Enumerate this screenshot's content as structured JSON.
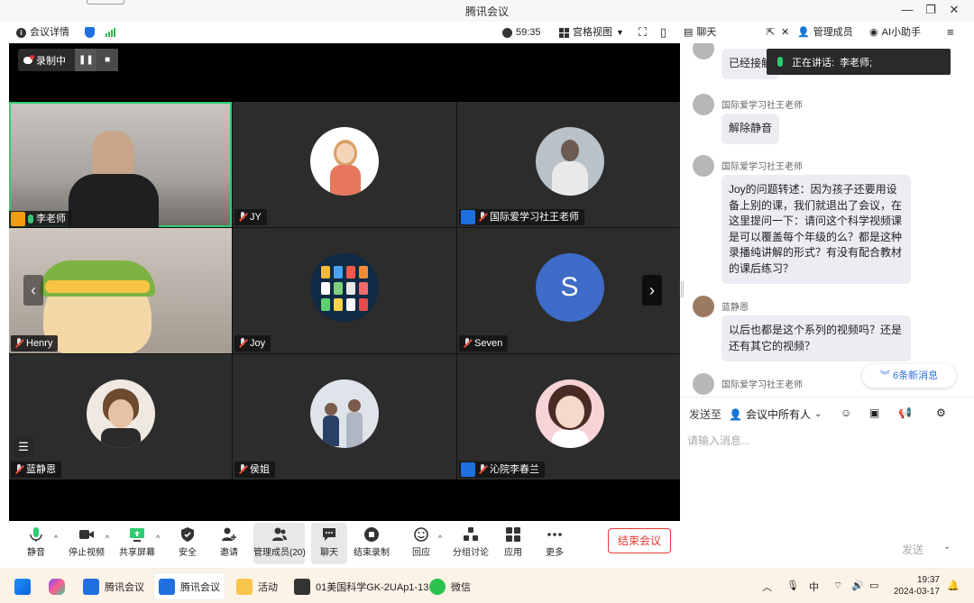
{
  "window": {
    "title": "腾讯会议"
  },
  "topbar": {
    "meeting_info": "会议详情",
    "timer": "59:35",
    "view_mode": "宫格视图"
  },
  "chat_header": {
    "chat": "聊天",
    "manage_members": "管理成员",
    "ai_assistant": "AI小助手"
  },
  "recording": {
    "label": "录制中"
  },
  "speaking": {
    "prefix": "正在讲话:",
    "name": "李老师;"
  },
  "tiles": [
    {
      "name": "李老师"
    },
    {
      "name": "JY"
    },
    {
      "name": "国际爱学习社王老师"
    },
    {
      "name": "Henry"
    },
    {
      "name": "Joy"
    },
    {
      "name": "Seven",
      "initial": "S"
    },
    {
      "name": "蓝静恩"
    },
    {
      "name": "侯姐"
    },
    {
      "name": "沁院李春兰"
    }
  ],
  "toolbar": {
    "mute": "静音",
    "stop_video": "停止视频",
    "share_screen": "共享屏幕",
    "security": "安全",
    "invite": "邀请",
    "members": "管理成员(20)",
    "chat": "聊天",
    "end_recording": "结束录制",
    "react": "回应",
    "breakout": "分组讨论",
    "apps": "应用",
    "more": "更多",
    "end_meeting": "结束会议"
  },
  "chat": {
    "messages": [
      {
        "sender": "",
        "text": "已经接触"
      },
      {
        "sender": "国际爱学习社王老师",
        "text": "解除静音"
      },
      {
        "sender": "国际爱学习社王老师",
        "text": "Joy的问题转述：因为孩子还要用设备上别的课，我们就退出了会议，在这里提问一下：请问这个科学视频课是可以覆盖每个年级的么？都是这种录播纯讲解的形式？有没有配合教材的课后练习？"
      },
      {
        "sender": "蓝静恩",
        "text": "以后也都是这个系列的视频吗？还是还有其它的视频？"
      },
      {
        "sender": "国际爱学习社王老师",
        "text": ""
      }
    ],
    "new_messages": "6条新消息",
    "send_to_label": "发送至",
    "send_to_target": "会议中所有人",
    "input_placeholder": "请输入消息...",
    "send": "发送"
  },
  "taskbar": {
    "items": [
      "腾讯会议",
      "腾讯会议",
      "活动",
      "01美国科学GK-2UAp1-13",
      "微信"
    ],
    "ime": "中",
    "time": "19:37",
    "date": "2024-03-17"
  },
  "colors": {
    "accent_blue": "#1f6fe0",
    "active_green": "#2ecc71",
    "end_red": "#e53935",
    "link_blue": "#2f6fde"
  }
}
